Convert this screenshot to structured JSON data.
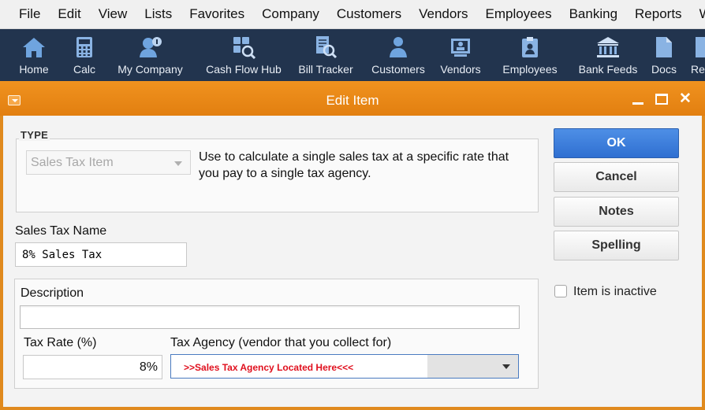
{
  "menu": [
    "File",
    "Edit",
    "View",
    "Lists",
    "Favorites",
    "Company",
    "Customers",
    "Vendors",
    "Employees",
    "Banking",
    "Reports",
    "Windo"
  ],
  "toolbar": [
    {
      "label": "Home",
      "icon": "home-icon"
    },
    {
      "label": "Calc",
      "icon": "calculator-icon"
    },
    {
      "label": "My Company",
      "icon": "company-icon"
    },
    {
      "label": "Cash Flow Hub",
      "icon": "cash-flow-hub-icon"
    },
    {
      "label": "Bill Tracker",
      "icon": "bill-tracker-icon"
    },
    {
      "label": "Customers",
      "icon": "customers-icon"
    },
    {
      "label": "Vendors",
      "icon": "vendors-icon"
    },
    {
      "label": "Employees",
      "icon": "employees-icon"
    },
    {
      "label": "Bank Feeds",
      "icon": "bank-icon"
    },
    {
      "label": "Docs",
      "icon": "document-icon"
    },
    {
      "label": "Repo",
      "icon": "reports-icon"
    }
  ],
  "window": {
    "title": "Edit Item",
    "accent_color": "#e8861a"
  },
  "form": {
    "type_legend": "TYPE",
    "type_value": "Sales Tax Item",
    "type_description": "Use to calculate a single sales tax at a specific rate that you pay to a single tax agency.",
    "name_label": "Sales Tax Name",
    "name_value": "8% Sales Tax",
    "description_label": "Description",
    "description_value": "",
    "rate_label": "Tax Rate (%)",
    "rate_value": "8%",
    "agency_label": "Tax Agency (vendor that you collect for)",
    "agency_value": ">>Sales Tax Agency Located Here<<<"
  },
  "buttons": {
    "ok": "OK",
    "cancel": "Cancel",
    "notes": "Notes",
    "spelling": "Spelling"
  },
  "inactive": {
    "label": "Item is inactive",
    "checked": false
  }
}
